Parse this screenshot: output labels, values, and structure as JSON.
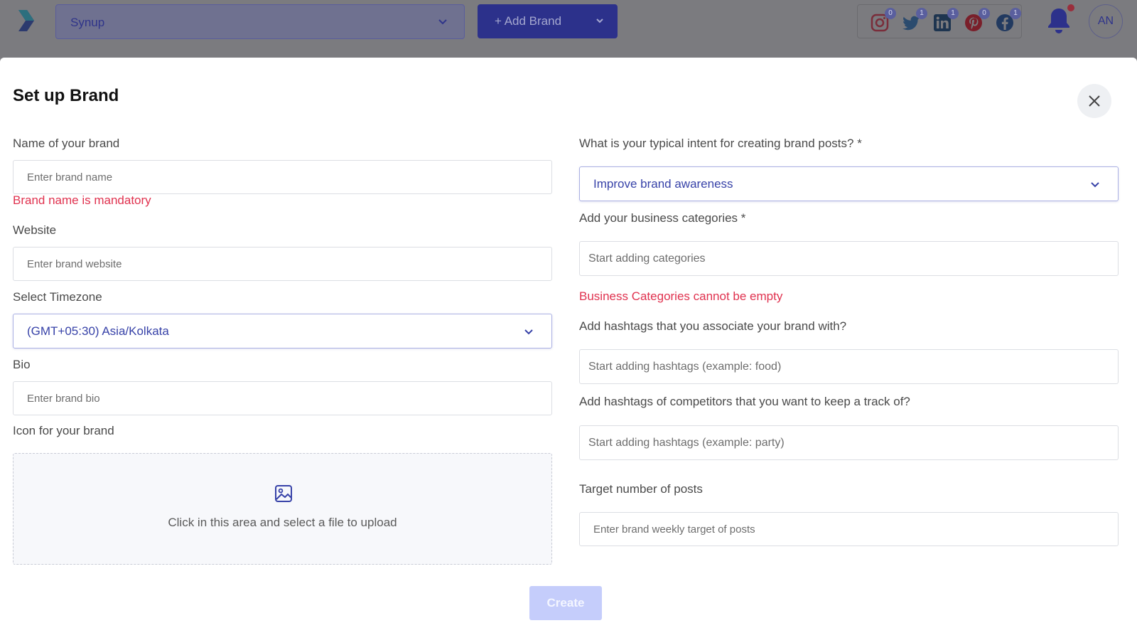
{
  "topbar": {
    "brand_selected": "Synup",
    "add_brand_label": "+ Add Brand",
    "avatar_initials": "AN",
    "socials": [
      {
        "name": "instagram",
        "count": "0"
      },
      {
        "name": "twitter",
        "count": "1"
      },
      {
        "name": "linkedin",
        "count": "1"
      },
      {
        "name": "pinterest",
        "count": "0"
      },
      {
        "name": "facebook",
        "count": "1"
      }
    ]
  },
  "dialog": {
    "title": "Set up Brand",
    "name_label": "Name of your brand",
    "name_placeholder": "Enter brand name",
    "name_error": "Brand name is mandatory",
    "website_label": "Website",
    "website_placeholder": "Enter brand website",
    "timezone_label": "Select Timezone",
    "timezone_value": "(GMT+05:30) Asia/Kolkata",
    "bio_label": "Bio",
    "bio_placeholder": "Enter brand bio",
    "icon_label": "Icon for your brand",
    "upload_text": "Click in this area and select a file to upload",
    "intent_label": "What is your typical intent for creating brand posts? *",
    "intent_value": "Improve brand awareness",
    "categories_label": "Add your business categories *",
    "categories_placeholder": "Start adding categories",
    "categories_error": "Business Categories cannot be empty",
    "hashtags_label": "Add hashtags that you associate your brand with?",
    "hashtags_placeholder": "Start adding hashtags (example: food)",
    "competitor_label": "Add hashtags of competitors that you want to keep a track of?",
    "competitor_placeholder": "Start adding hashtags (example: party)",
    "target_label": "Target number of posts",
    "target_placeholder": "Enter brand weekly target of posts",
    "create_label": "Create"
  },
  "colors": {
    "accent": "#3742a8",
    "error": "#e0324f",
    "create_disabled": "#c5cdfb"
  }
}
